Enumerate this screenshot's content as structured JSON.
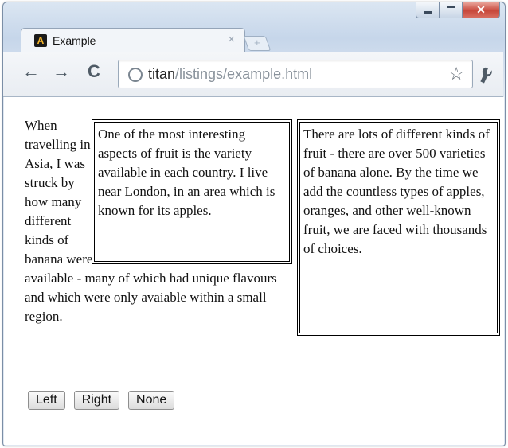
{
  "window": {
    "controls": [
      "minimize",
      "maximize",
      "close"
    ]
  },
  "tab": {
    "title": "Example",
    "favicon_letter": "A",
    "close_glyph": "×",
    "newtab_glyph": "+"
  },
  "toolbar": {
    "back_icon": "←",
    "forward_icon": "→",
    "reload_icon": "C",
    "url_host": "titan",
    "url_path": "/listings/example.html",
    "star_icon": "☆",
    "wrench_icon": "🔧"
  },
  "page": {
    "left_paragraph": "When travelling in Asia, I was struck by how many different kinds of banana were available - many of which had unique flavours and which were only avaiable within a small region.",
    "box1": "One of the most interesting aspects of fruit is the variety available in each country. I live near London, in an area which is known for its apples.",
    "box2": "There are lots of different kinds of fruit - there are over 500 varieties of banana alone. By the time we add the countless types of apples, oranges, and other well-known fruit, we are faced with thousands of choices.",
    "buttons": {
      "left": "Left",
      "right": "Right",
      "none": "None"
    }
  }
}
